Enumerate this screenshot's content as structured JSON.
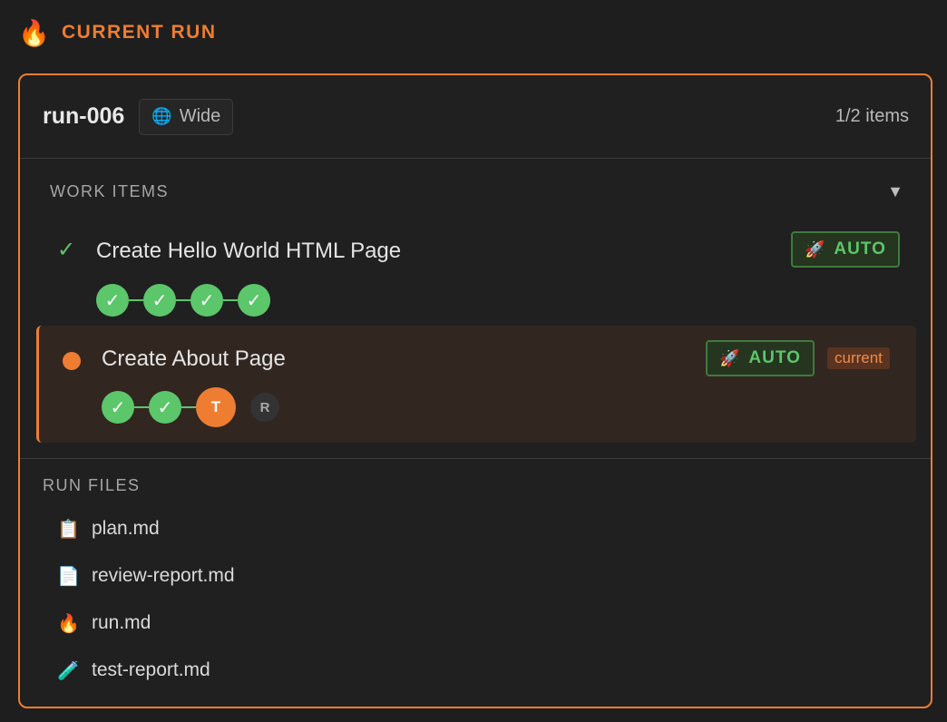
{
  "header": {
    "icon": "fire-icon",
    "title": "CURRENT RUN"
  },
  "run": {
    "id": "run-006",
    "scope_icon": "globe-icon",
    "scope_label": "Wide",
    "items_count": "1/2 items"
  },
  "work_items_section": {
    "label": "WORK ITEMS",
    "collapse_glyph": "▼",
    "items": [
      {
        "status": "done",
        "status_glyph": "✓",
        "title": "Create Hello World HTML Page",
        "mode_icon": "rocket-icon",
        "mode_label": "AUTO",
        "stages": [
          "✓",
          "✓",
          "✓",
          "✓"
        ]
      },
      {
        "status": "current",
        "title": "Create About Page",
        "mode_icon": "rocket-icon",
        "mode_label": "AUTO",
        "current_label": "current",
        "stages": [
          "✓",
          "✓",
          "T",
          "R"
        ]
      }
    ]
  },
  "run_files": {
    "label": "RUN FILES",
    "files": [
      {
        "icon": "clipboard-icon",
        "name": "plan.md"
      },
      {
        "icon": "document-icon",
        "name": "review-report.md"
      },
      {
        "icon": "fire-icon",
        "name": "run.md"
      },
      {
        "icon": "test-tube-icon",
        "name": "test-report.md"
      }
    ]
  },
  "colors": {
    "accent": "#ee7d32",
    "success": "#5cc66b",
    "background": "#1e1e1e"
  }
}
